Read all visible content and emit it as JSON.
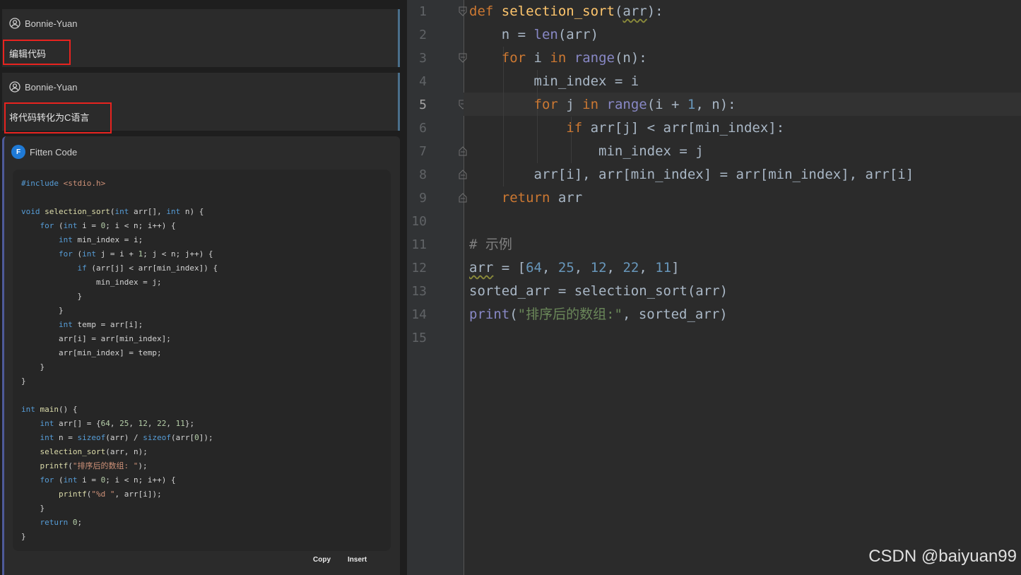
{
  "chat": {
    "messages": [
      {
        "author": "Bonnie-Yuan",
        "text": "编辑代码"
      },
      {
        "author": "Bonnie-Yuan",
        "text": "将代码转化为C语言"
      }
    ],
    "bot": {
      "author": "Fitten Code",
      "code_lines": [
        "#include <stdio.h>",
        "",
        "void selection_sort(int arr[], int n) {",
        "    for (int i = 0; i < n; i++) {",
        "        int min_index = i;",
        "        for (int j = i + 1; j < n; j++) {",
        "            if (arr[j] < arr[min_index]) {",
        "                min_index = j;",
        "            }",
        "        }",
        "        int temp = arr[i];",
        "        arr[i] = arr[min_index];",
        "        arr[min_index] = temp;",
        "    }",
        "}",
        "",
        "int main() {",
        "    int arr[] = {64, 25, 12, 22, 11};",
        "    int n = sizeof(arr) / sizeof(arr[0]);",
        "    selection_sort(arr, n);",
        "    printf(\"排序后的数组: \");",
        "    for (int i = 0; i < n; i++) {",
        "        printf(\"%d \", arr[i]);",
        "    }",
        "    return 0;",
        "}"
      ],
      "copy_label": "Copy",
      "insert_label": "Insert"
    }
  },
  "editor": {
    "active_line": 5,
    "line_numbers": [
      "1",
      "2",
      "3",
      "4",
      "5",
      "6",
      "7",
      "8",
      "9",
      "10",
      "11",
      "12",
      "13",
      "14",
      "15"
    ],
    "lines": [
      "def selection_sort(arr):",
      "    n = len(arr)",
      "    for i in range(n):",
      "        min_index = i",
      "        for j in range(i + 1, n):",
      "            if arr[j] < arr[min_index]:",
      "                min_index = j",
      "        arr[i], arr[min_index] = arr[min_index], arr[i]",
      "    return arr",
      "",
      "# 示例",
      "arr = [64, 25, 12, 22, 11]",
      "sorted_arr = selection_sort(arr)",
      "print(\"排序后的数组:\", sorted_arr)",
      ""
    ]
  },
  "watermark": "CSDN @baiyuan99",
  "colors": {
    "highlight_box": "#e8231f",
    "keyword": "#cc7832",
    "function": "#ffc66d",
    "number": "#6897bb",
    "string": "#6a8759"
  }
}
